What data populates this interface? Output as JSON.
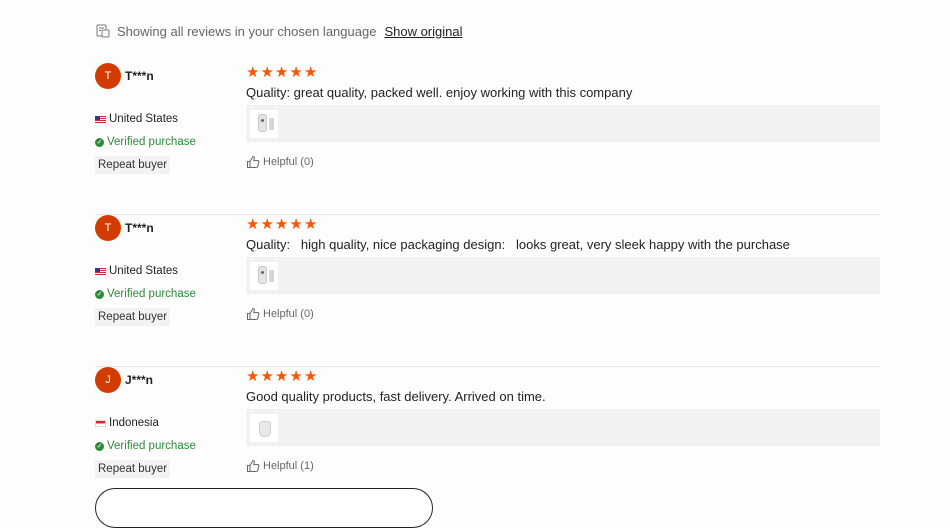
{
  "language_bar": {
    "notice": "Showing all reviews in your chosen language",
    "show_original": "Show original"
  },
  "reviews": [
    {
      "avatar_letter": "T",
      "name": "T***n",
      "country": "United States",
      "flag": "us",
      "verified": "Verified purchase",
      "badge": "Repeat buyer",
      "rating": 5,
      "text": "Quality: great quality, packed well. enjoy working with this company",
      "helpful": "Helpful (0)"
    },
    {
      "avatar_letter": "T",
      "name": "T***n",
      "country": "United States",
      "flag": "us",
      "verified": "Verified purchase",
      "badge": "Repeat buyer",
      "rating": 5,
      "text": "Quality:   high quality, nice packaging design:   looks great, very sleek happy with the purchase",
      "helpful": "Helpful (0)"
    },
    {
      "avatar_letter": "J",
      "name": "J***n",
      "country": "Indonesia",
      "flag": "id",
      "verified": "Verified purchase",
      "badge": "Repeat buyer",
      "rating": 5,
      "text": "Good quality products, fast delivery. Arrived on time.",
      "helpful": "Helpful (1)"
    }
  ],
  "colors": {
    "accent": "#ff5500",
    "avatar": "#d33c00",
    "verified": "#2e8b3e"
  }
}
